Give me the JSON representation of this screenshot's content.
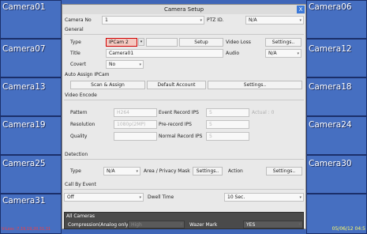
{
  "cameras": {
    "c01": "Camera01",
    "c06": "Camera06",
    "c07": "Camera07",
    "c12": "Camera12",
    "c13": "Camera13",
    "c18": "Camera18",
    "c19": "Camera19",
    "c24": "Camera24",
    "c25": "Camera25",
    "c30": "Camera30",
    "c31": "Camera31"
  },
  "status": {
    "loss": "V-Loss :7,19,19,20,31,31",
    "datetime": "05/06/12 04:5"
  },
  "dialog": {
    "title": "Camera Setup",
    "close": "X",
    "camera_no_label": "Camera No",
    "camera_no_value": "1",
    "ptz_label": "PTZ ID.",
    "ptz_value": "N/A",
    "general": "General",
    "type_label": "Type",
    "type_value": "IPCam 2",
    "setup": "Setup",
    "video_loss_label": "Video Loss",
    "video_loss_settings": "Settings..",
    "title_label": "Title",
    "title_value": "Camera01",
    "audio_label": "Audio",
    "audio_value": "N/A",
    "covert_label": "Covert",
    "covert_value": "No",
    "auto_assign": "Auto Assign IPCam",
    "scan_assign": "Scan & Assign",
    "default_account": "Default Account",
    "auto_settings": "Settings..",
    "video_encode": "Video Encode",
    "pattern_label": "Pattern",
    "pattern_value": "H264",
    "event_ips_label": "Event Record IPS",
    "event_ips_value": "5",
    "actual_label": "Actual : 0",
    "resolution_label": "Resolution",
    "resolution_value": "1080p(2MP)",
    "prerecord_label": "Pre-record IPS",
    "prerecord_value": "5",
    "quality_label": "Quality",
    "normal_ips_label": "Normal Record IPS",
    "normal_ips_value": "5",
    "detection": "Detection",
    "det_type_label": "Type",
    "det_type_value": "N/A",
    "area_label": "Area / Privacy Mask",
    "area_settings": "Settings..",
    "action_label": "Action",
    "action_settings": "Settings..",
    "call_by_event": "Call By Event",
    "call_value": "Off",
    "dwell_label": "Dwell Time",
    "dwell_value": "10 Sec.",
    "all_cameras": "All Cameras",
    "compression_label": "Compression(Analog only)",
    "compression_value": "High",
    "watermark_label": "Wazer Mark",
    "watermark_value": "YES"
  },
  "colors": {
    "background": "#3f66b8",
    "highlight_border": "#d00000",
    "highlight_fill": "#f4c9c1",
    "title_button": "#3b79d9"
  },
  "icons": {
    "dropdown": "chevron-down-icon",
    "close": "close-icon"
  }
}
